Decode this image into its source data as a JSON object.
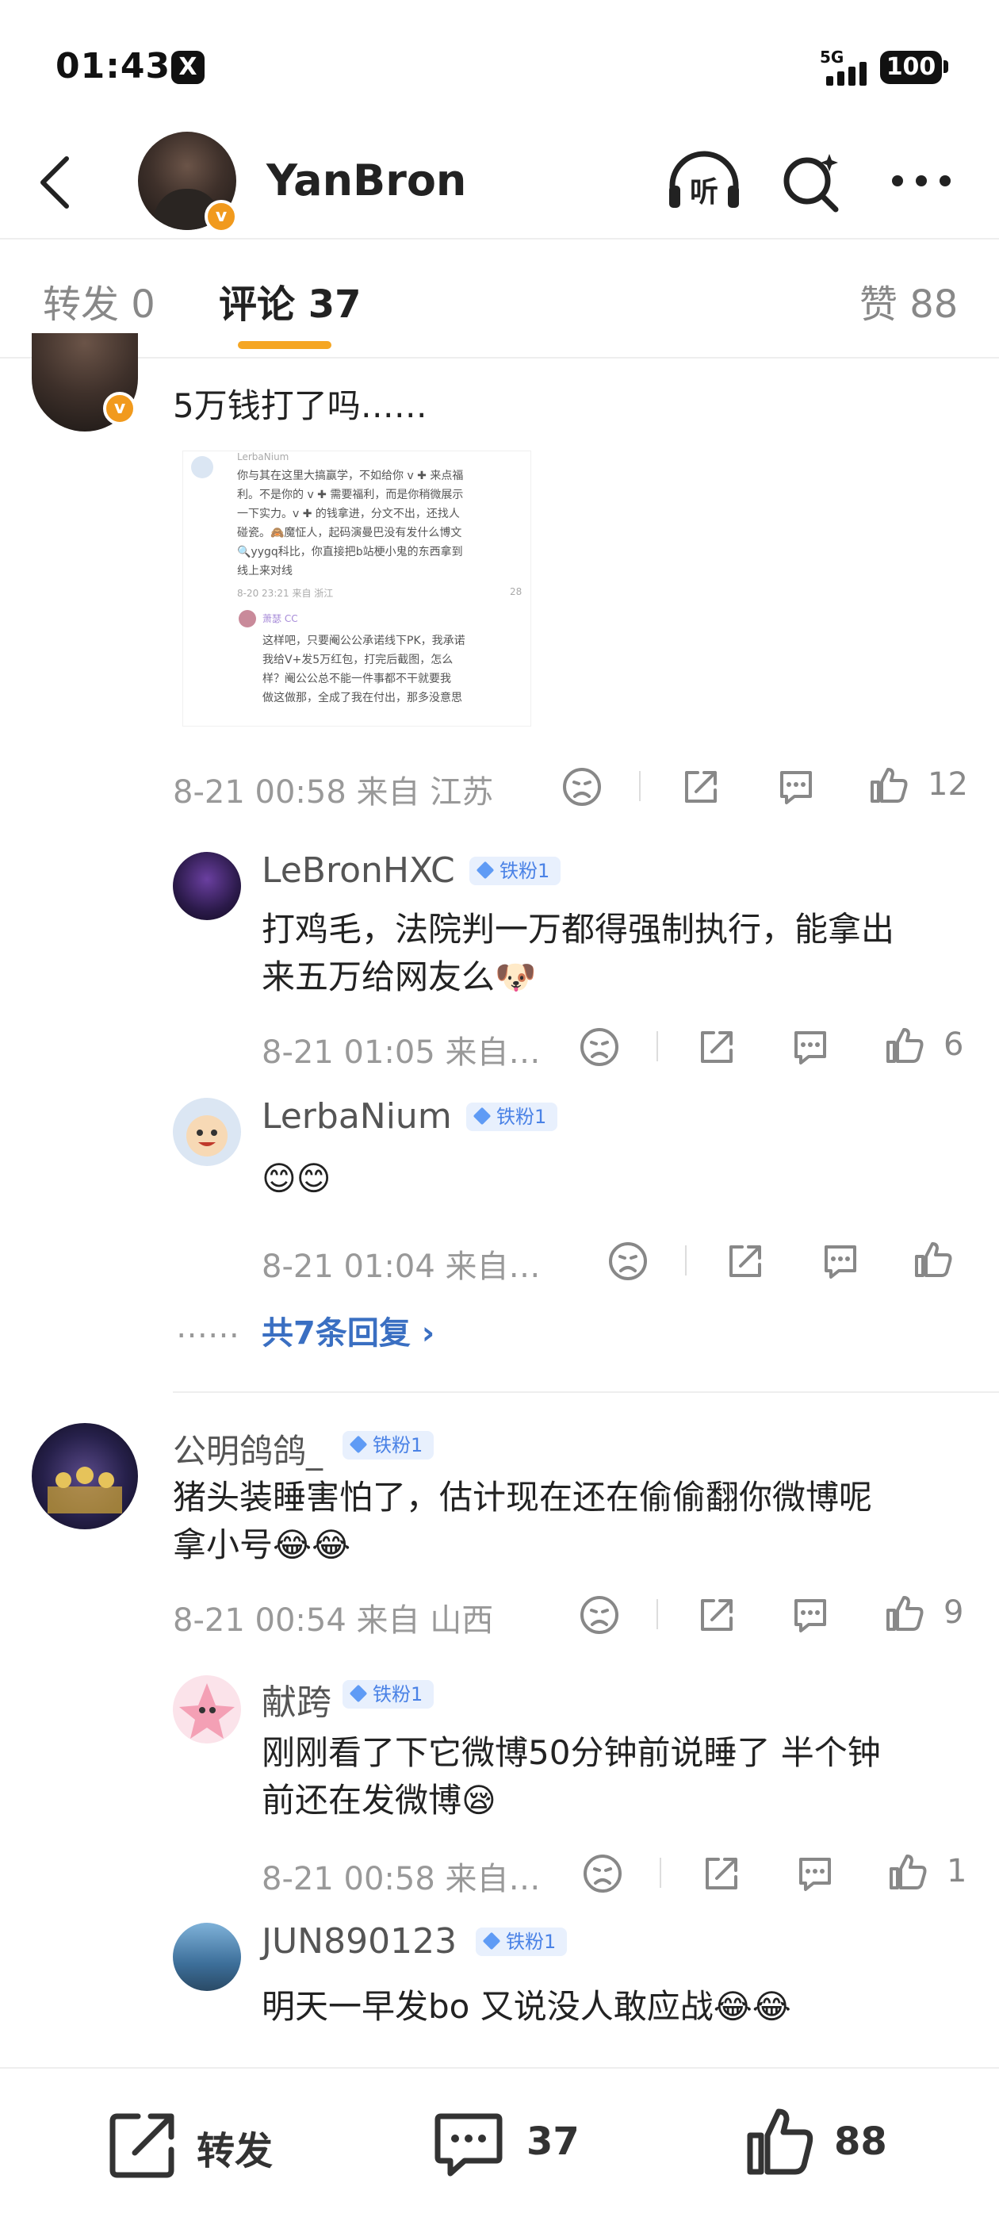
{
  "status_bar": {
    "time": "01:43",
    "network": "5G",
    "battery": "100"
  },
  "header": {
    "name": "YanBron",
    "listen_label": "听"
  },
  "tabs": {
    "repost": "转发 0",
    "comments": "评论 37",
    "likes": "赞 88"
  },
  "comments": [
    {
      "text": "5万钱打了吗……",
      "embedded_image": {
        "lines": [
          "LerbaNium",
          "你与其在这里大搞赢学，不如给你 v ✚ 来点福",
          "利。不是你的 v ✚ 需要福利，而是你稍微展示",
          "一下实力。v ✚ 的钱拿进，分文不出，还找人",
          "碰瓷。🙈魔怔人，起码演曼巴没有发什么博文",
          "🔍yygq科比，你直接把b站梗小鬼的东西拿到",
          "线上来对线",
          "8-20 23:21 来自 浙江",
          "萧瑟 CC",
          "这样吧，只要阉公公承诺线下PK，我承诺",
          "我给V+发5万红包，打完后截图，怎么",
          "样？阉公公总不能一件事都不干就要我",
          "做这做那，全成了我在付出，那多没意思"
        ],
        "like_count": "28"
      },
      "meta": "8-21 00:58  来自 江苏",
      "likes": "12",
      "replies": [
        {
          "name": "LeBronHXC",
          "badge": "铁粉1",
          "text_lines": [
            "打鸡毛，法院判一万都得强制执行，能拿出",
            "来五万给网友么🐶"
          ],
          "meta": "8-21 01:05  来自…",
          "likes": "6"
        },
        {
          "name": "LerbaNium",
          "badge": "铁粉1",
          "text_lines": [
            "😊😊"
          ],
          "meta": "8-21 01:04  来自…",
          "likes": ""
        }
      ],
      "more_dots": "……",
      "more_link": "共7条回复 ›"
    },
    {
      "name": "公明鸽鸽_",
      "badge": "铁粉1",
      "text_lines": [
        "猪头装睡害怕了，估计现在还在偷偷翻你微博呢",
        "拿小号😂😂"
      ],
      "meta": "8-21 00:54  来自 山西",
      "likes": "9",
      "replies": [
        {
          "name": "献跨",
          "badge": "铁粉1",
          "text_lines": [
            "刚刚看了下它微博50分钟前说睡了 半个钟",
            "前还在发微博😪"
          ],
          "meta": "8-21 00:58  来自…",
          "likes": "1"
        },
        {
          "name": "JUN890123",
          "badge": "铁粉1",
          "text_lines": [
            "明天一早发bo 又说没人敢应战😂😂"
          ]
        }
      ]
    }
  ],
  "bottom_bar": {
    "repost": "转发",
    "comments": "37",
    "likes": "88"
  },
  "colors": {
    "accent": "#f5a623",
    "link": "#3a6fc2",
    "fan_badge": "#4a82e6",
    "verified": "#f19a1d"
  }
}
